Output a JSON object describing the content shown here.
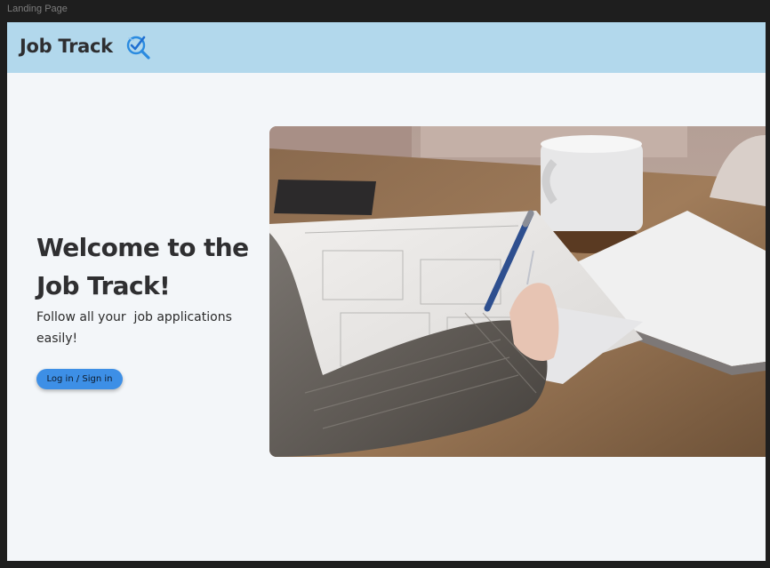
{
  "frame": {
    "label": "Landing Page"
  },
  "navbar": {
    "brand": "Job Track",
    "logo_icon": "magnifier-check-icon"
  },
  "hero": {
    "title": "Welcome to the Job Track!",
    "subtitle": "Follow all your  job applications easily!",
    "button_label": "Log in / Sign in",
    "image_description_icon": "hand-writing-photo"
  },
  "colors": {
    "navbar_bg": "#b2d8ec",
    "page_bg": "#f3f6f9",
    "button_bg": "#3d8fe6",
    "text_dark": "#2f2f31"
  }
}
